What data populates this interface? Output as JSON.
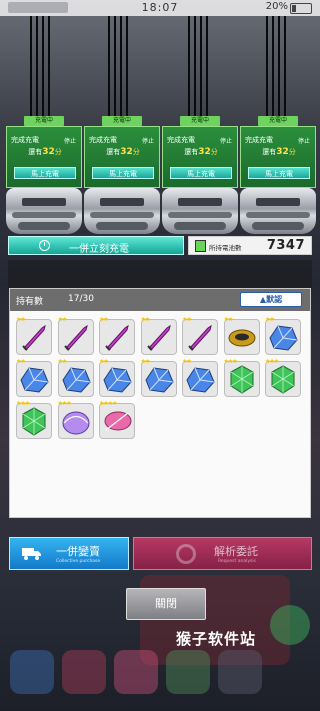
{
  "status_bar": {
    "time": "18:07",
    "battery": "20%"
  },
  "chargers": [
    {
      "tag": "充電中",
      "status": "完成充電",
      "stop": "停止",
      "remain_prefix": "還有",
      "remain_value": "32",
      "remain_unit": "分",
      "button": "馬上充電"
    },
    {
      "tag": "充電中",
      "status": "完成充電",
      "stop": "停止",
      "remain_prefix": "還有",
      "remain_value": "32",
      "remain_unit": "分",
      "button": "馬上充電"
    },
    {
      "tag": "充電中",
      "status": "完成充電",
      "stop": "停止",
      "remain_prefix": "還有",
      "remain_value": "32",
      "remain_unit": "分",
      "button": "馬上充電"
    },
    {
      "tag": "充電中",
      "status": "完成充電",
      "stop": "停止",
      "remain_prefix": "還有",
      "remain_value": "32",
      "remain_unit": "分",
      "button": "馬上充電"
    }
  ],
  "charge_all": {
    "label": "一併立刻充電"
  },
  "battery_count": {
    "label": "所持電池數",
    "value": "7347"
  },
  "inventory": {
    "label": "持有數",
    "count": "17/30",
    "sort_button": "▲默認",
    "items": [
      {
        "type": "sword",
        "color": "#c43cc8",
        "stars": "★★"
      },
      {
        "type": "sword",
        "color": "#c43cc8",
        "stars": "★★"
      },
      {
        "type": "sword",
        "color": "#c43cc8",
        "stars": "★★"
      },
      {
        "type": "sword",
        "color": "#c43cc8",
        "stars": "★★"
      },
      {
        "type": "sword",
        "color": "#c43cc8",
        "stars": "★★"
      },
      {
        "type": "disc",
        "color": "#c99b1c",
        "stars": "★★"
      },
      {
        "type": "crystal",
        "color": "#4a86e8",
        "stars": "★★"
      },
      {
        "type": "crystal",
        "color": "#4a86e8",
        "stars": "★★"
      },
      {
        "type": "crystal",
        "color": "#4a86e8",
        "stars": "★★"
      },
      {
        "type": "crystal",
        "color": "#4a86e8",
        "stars": "★★"
      },
      {
        "type": "crystal",
        "color": "#4a86e8",
        "stars": "★★"
      },
      {
        "type": "crystal",
        "color": "#4a86e8",
        "stars": "★★"
      },
      {
        "type": "gem",
        "color": "#3fc45a",
        "stars": "★★★"
      },
      {
        "type": "gem",
        "color": "#3fc45a",
        "stars": "★★★"
      },
      {
        "type": "gem",
        "color": "#3fc45a",
        "stars": "★★★"
      },
      {
        "type": "shell",
        "color": "#b48cf0",
        "stars": "★★★"
      },
      {
        "type": "feather",
        "color": "#e86aa8",
        "stars": "★★★★"
      }
    ]
  },
  "actions": {
    "sell_all": "一併變賣",
    "sell_all_sub": "Collective purchase",
    "analyze": "解析委託",
    "analyze_sub": "Request analysis",
    "close": "關閉"
  },
  "watermark": "猴子软件站"
}
